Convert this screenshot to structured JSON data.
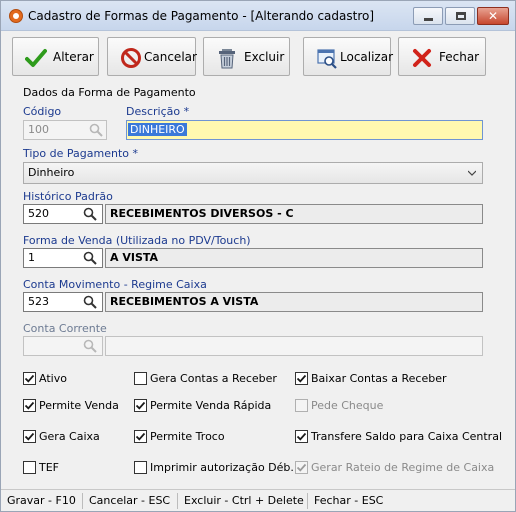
{
  "window": {
    "title": "Cadastro de Formas de Pagamento - [Alterando cadastro]",
    "icon": "app-icon"
  },
  "toolbar": {
    "alterar": "Alterar",
    "cancelar": "Cancelar",
    "excluir": "Excluir",
    "localizar": "Localizar",
    "fechar": "Fechar"
  },
  "form": {
    "section_title": "Dados da Forma de Pagamento",
    "codigo_label": "Código",
    "codigo_value": "100",
    "descricao_label": "Descrição *",
    "descricao_value": "DINHEIRO",
    "tipo_label": "Tipo de Pagamento *",
    "tipo_value": "Dinheiro",
    "historico_label": "Histórico Padrão",
    "historico_code": "520",
    "historico_desc": "RECEBIMENTOS DIVERSOS - C",
    "forma_venda_label": "Forma de Venda (Utilizada no PDV/Touch)",
    "forma_venda_code": "1",
    "forma_venda_desc": "A VISTA",
    "conta_mov_label": "Conta Movimento - Regime Caixa",
    "conta_mov_code": "523",
    "conta_mov_desc": "RECEBIMENTOS A VISTA",
    "conta_corrente_label": "Conta Corrente",
    "conta_corrente_code": "",
    "conta_corrente_desc": ""
  },
  "options": {
    "ativo": "Ativo",
    "gera_contas_receber": "Gera Contas a Receber",
    "baixar_contas_receber": "Baixar Contas a Receber",
    "permite_venda": "Permite Venda",
    "permite_venda_rapida": "Permite Venda Rápida",
    "pede_cheque": "Pede Cheque",
    "gera_caixa": "Gera Caixa",
    "permite_troco": "Permite Troco",
    "transfere_saldo": "Transfere Saldo para Caixa Central",
    "tef": "TEF",
    "imprimir_autorizacao": "Imprimir autorização Déb.",
    "gerar_rateio": "Gerar Rateio de Regime de Caixa"
  },
  "checked": {
    "ativo": true,
    "gera_contas_receber": false,
    "baixar_contas_receber": true,
    "permite_venda": true,
    "permite_venda_rapida": true,
    "pede_cheque": false,
    "gera_caixa": true,
    "permite_troco": true,
    "transfere_saldo": true,
    "tef": false,
    "imprimir_autorizacao": false,
    "gerar_rateio": true
  },
  "statusbar": {
    "gravar": "Gravar - F10",
    "cancelar": "Cancelar - ESC",
    "excluir": "Excluir - Ctrl + Delete",
    "fechar": "Fechar - ESC"
  },
  "colors": {
    "label_blue": "#1c3a8f",
    "description_bg": "#fff9b0",
    "selection": "#3a79d9"
  }
}
